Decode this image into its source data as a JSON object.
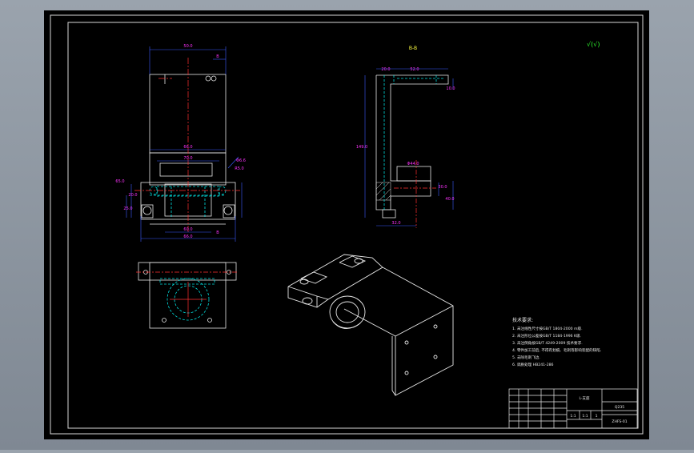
{
  "drawing": {
    "section_label": "B-B",
    "roughness_symbol": "√(√)",
    "dims": {
      "top_width": "50.0",
      "mid_width": "66.0",
      "inner_width": "70.0",
      "bottom_width": "60.0",
      "base_width": "66.0",
      "left_1": "65.0",
      "left_2": "25.0",
      "left_3": "20.0",
      "right_1": "Φ6.6",
      "right_2": "R5.0",
      "section_top_left": "20.0",
      "section_top_mid": "52.0",
      "section_top_right": "10.0",
      "section_height": "149.0",
      "section_hole": "Φ44.0",
      "section_side": "30.0",
      "section_bottom": "40.0",
      "section_foot": "32.0",
      "left_mark": "B",
      "bottom_mark": "B"
    },
    "tech_req": {
      "title": "技术要求:",
      "items": [
        "1. 未注线性尺寸按GB/T 1804-2000 m级.",
        "2. 未注形位公差按GB/T 1184-1996 K级.",
        "3. 未注倒角按GB/T 4249-2009 技术要求.",
        "4. 零件加工前后, 不得有划痕、毛刺等影响装配的缺陷.",
        "5. 去除毛刺飞边.",
        "6. 调质处理 HB241-286"
      ]
    },
    "title_block": {
      "name": "L-支座",
      "material": "Q235",
      "scale": "1:1",
      "code": "ZHFS-01",
      "qty": "1",
      "ratio": "1:1"
    }
  }
}
